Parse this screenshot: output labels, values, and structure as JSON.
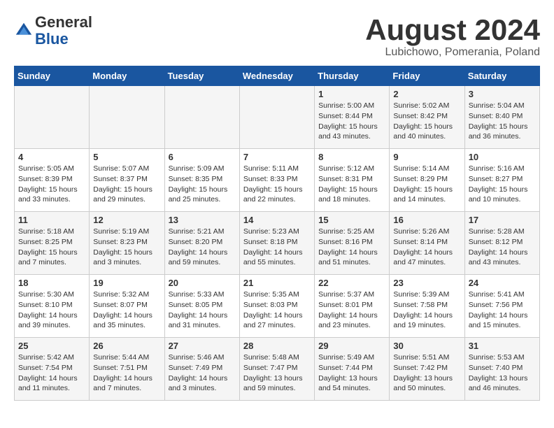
{
  "header": {
    "logo_line1": "General",
    "logo_line2": "Blue",
    "month": "August 2024",
    "location": "Lubichowo, Pomerania, Poland"
  },
  "weekdays": [
    "Sunday",
    "Monday",
    "Tuesday",
    "Wednesday",
    "Thursday",
    "Friday",
    "Saturday"
  ],
  "weeks": [
    [
      {
        "day": "",
        "text": ""
      },
      {
        "day": "",
        "text": ""
      },
      {
        "day": "",
        "text": ""
      },
      {
        "day": "",
        "text": ""
      },
      {
        "day": "1",
        "text": "Sunrise: 5:00 AM\nSunset: 8:44 PM\nDaylight: 15 hours\nand 43 minutes."
      },
      {
        "day": "2",
        "text": "Sunrise: 5:02 AM\nSunset: 8:42 PM\nDaylight: 15 hours\nand 40 minutes."
      },
      {
        "day": "3",
        "text": "Sunrise: 5:04 AM\nSunset: 8:40 PM\nDaylight: 15 hours\nand 36 minutes."
      }
    ],
    [
      {
        "day": "4",
        "text": "Sunrise: 5:05 AM\nSunset: 8:39 PM\nDaylight: 15 hours\nand 33 minutes."
      },
      {
        "day": "5",
        "text": "Sunrise: 5:07 AM\nSunset: 8:37 PM\nDaylight: 15 hours\nand 29 minutes."
      },
      {
        "day": "6",
        "text": "Sunrise: 5:09 AM\nSunset: 8:35 PM\nDaylight: 15 hours\nand 25 minutes."
      },
      {
        "day": "7",
        "text": "Sunrise: 5:11 AM\nSunset: 8:33 PM\nDaylight: 15 hours\nand 22 minutes."
      },
      {
        "day": "8",
        "text": "Sunrise: 5:12 AM\nSunset: 8:31 PM\nDaylight: 15 hours\nand 18 minutes."
      },
      {
        "day": "9",
        "text": "Sunrise: 5:14 AM\nSunset: 8:29 PM\nDaylight: 15 hours\nand 14 minutes."
      },
      {
        "day": "10",
        "text": "Sunrise: 5:16 AM\nSunset: 8:27 PM\nDaylight: 15 hours\nand 10 minutes."
      }
    ],
    [
      {
        "day": "11",
        "text": "Sunrise: 5:18 AM\nSunset: 8:25 PM\nDaylight: 15 hours\nand 7 minutes."
      },
      {
        "day": "12",
        "text": "Sunrise: 5:19 AM\nSunset: 8:23 PM\nDaylight: 15 hours\nand 3 minutes."
      },
      {
        "day": "13",
        "text": "Sunrise: 5:21 AM\nSunset: 8:20 PM\nDaylight: 14 hours\nand 59 minutes."
      },
      {
        "day": "14",
        "text": "Sunrise: 5:23 AM\nSunset: 8:18 PM\nDaylight: 14 hours\nand 55 minutes."
      },
      {
        "day": "15",
        "text": "Sunrise: 5:25 AM\nSunset: 8:16 PM\nDaylight: 14 hours\nand 51 minutes."
      },
      {
        "day": "16",
        "text": "Sunrise: 5:26 AM\nSunset: 8:14 PM\nDaylight: 14 hours\nand 47 minutes."
      },
      {
        "day": "17",
        "text": "Sunrise: 5:28 AM\nSunset: 8:12 PM\nDaylight: 14 hours\nand 43 minutes."
      }
    ],
    [
      {
        "day": "18",
        "text": "Sunrise: 5:30 AM\nSunset: 8:10 PM\nDaylight: 14 hours\nand 39 minutes."
      },
      {
        "day": "19",
        "text": "Sunrise: 5:32 AM\nSunset: 8:07 PM\nDaylight: 14 hours\nand 35 minutes."
      },
      {
        "day": "20",
        "text": "Sunrise: 5:33 AM\nSunset: 8:05 PM\nDaylight: 14 hours\nand 31 minutes."
      },
      {
        "day": "21",
        "text": "Sunrise: 5:35 AM\nSunset: 8:03 PM\nDaylight: 14 hours\nand 27 minutes."
      },
      {
        "day": "22",
        "text": "Sunrise: 5:37 AM\nSunset: 8:01 PM\nDaylight: 14 hours\nand 23 minutes."
      },
      {
        "day": "23",
        "text": "Sunrise: 5:39 AM\nSunset: 7:58 PM\nDaylight: 14 hours\nand 19 minutes."
      },
      {
        "day": "24",
        "text": "Sunrise: 5:41 AM\nSunset: 7:56 PM\nDaylight: 14 hours\nand 15 minutes."
      }
    ],
    [
      {
        "day": "25",
        "text": "Sunrise: 5:42 AM\nSunset: 7:54 PM\nDaylight: 14 hours\nand 11 minutes."
      },
      {
        "day": "26",
        "text": "Sunrise: 5:44 AM\nSunset: 7:51 PM\nDaylight: 14 hours\nand 7 minutes."
      },
      {
        "day": "27",
        "text": "Sunrise: 5:46 AM\nSunset: 7:49 PM\nDaylight: 14 hours\nand 3 minutes."
      },
      {
        "day": "28",
        "text": "Sunrise: 5:48 AM\nSunset: 7:47 PM\nDaylight: 13 hours\nand 59 minutes."
      },
      {
        "day": "29",
        "text": "Sunrise: 5:49 AM\nSunset: 7:44 PM\nDaylight: 13 hours\nand 54 minutes."
      },
      {
        "day": "30",
        "text": "Sunrise: 5:51 AM\nSunset: 7:42 PM\nDaylight: 13 hours\nand 50 minutes."
      },
      {
        "day": "31",
        "text": "Sunrise: 5:53 AM\nSunset: 7:40 PM\nDaylight: 13 hours\nand 46 minutes."
      }
    ]
  ]
}
